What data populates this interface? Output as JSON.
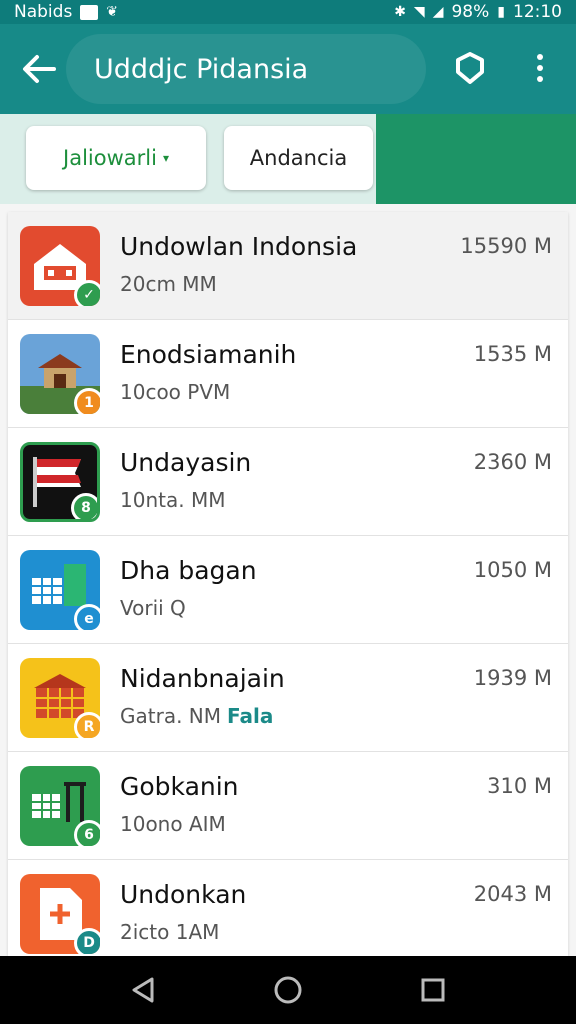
{
  "status_bar": {
    "carrier": "Nabids",
    "battery": "98%",
    "time": "12:10"
  },
  "app_bar": {
    "title": "Udddjc Pidansia",
    "back_icon": "arrow-left-icon",
    "action_icon": "shield-icon",
    "more_icon": "more-vert-icon"
  },
  "filters": [
    {
      "label": "Jaliowarli",
      "selected": true
    },
    {
      "label": "Andancia",
      "selected": false
    }
  ],
  "apps": [
    {
      "title": "Undowlan Indonsia",
      "subtitle": "20cm MM",
      "tag": "",
      "size": "15590 M",
      "icon_color": "#e24b2f",
      "badge_color": "#2e9d4f"
    },
    {
      "title": "Enodsiamanih",
      "subtitle": "10coo PVM",
      "tag": "",
      "size": "1535 M",
      "icon_color": "#4a7f3a",
      "badge_color": "#f08c1e"
    },
    {
      "title": "Undayasin",
      "subtitle": "10nta. MM",
      "tag": "",
      "size": "2360 M",
      "icon_color": "#111111",
      "badge_color": "#2e9d4f"
    },
    {
      "title": "Dha bagan",
      "subtitle": "Vorii  Q",
      "tag": "",
      "size": "1050 M",
      "icon_color": "#1f8fd1",
      "badge_color": "#1f8fd1"
    },
    {
      "title": "Nidanbnajain",
      "subtitle": "Gatra. NM",
      "tag": "Fala",
      "size": "1939 M",
      "icon_color": "#f5c21a",
      "badge_color": "#f5a623"
    },
    {
      "title": "Gobkanin",
      "subtitle": "10ono AIM",
      "tag": "",
      "size": "310 M",
      "icon_color": "#2e9d4f",
      "badge_color": "#2e9d4f"
    },
    {
      "title": "Undonkan",
      "subtitle": "2icto 1AM",
      "tag": "",
      "size": "2043 M",
      "icon_color": "#f0622e",
      "badge_color": "#1b8a88"
    }
  ]
}
